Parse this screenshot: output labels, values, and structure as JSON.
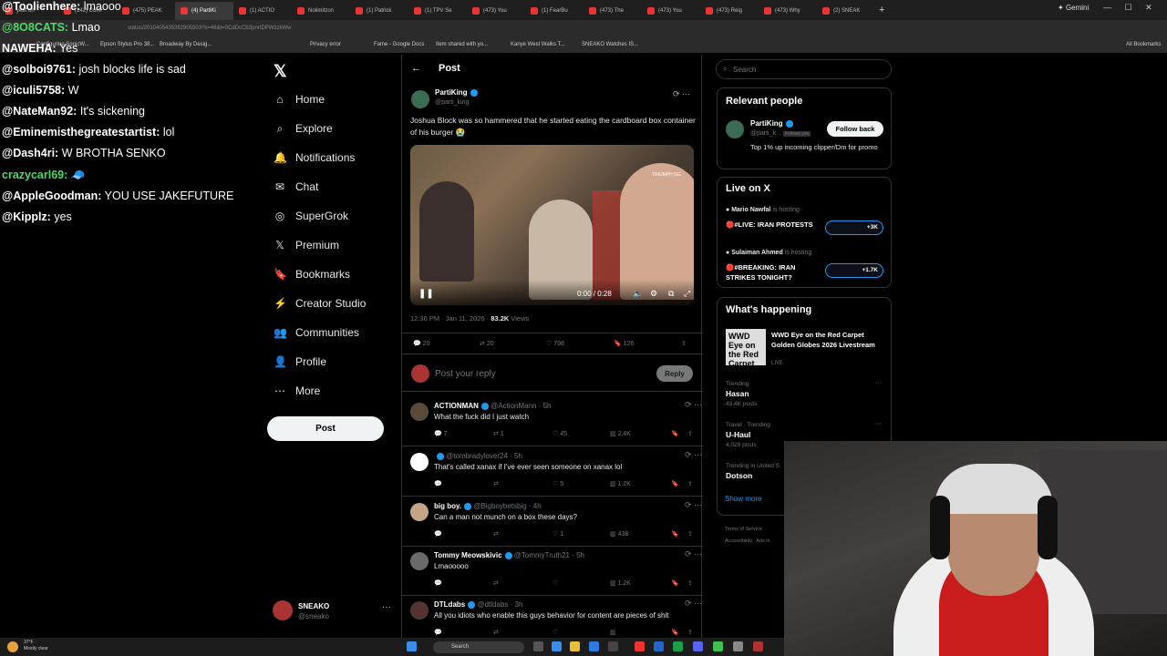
{
  "browser": {
    "tabs": [
      "yeet on",
      "(142) Confi",
      "(475) PEAK",
      "(4) PartiKi",
      "(1) ACTIO",
      "Nolimitzon",
      "(1) Patrick",
      "(1) TPV Se",
      "(473) You",
      "(1) FearBu",
      "(473) The",
      "(473) You",
      "(473) Reig",
      "(473) Why",
      "(2) SNEAK"
    ],
    "gemini_label": "Gemini",
    "url": "status/2010405435392905503?s=46&t=0CdDcCb3pnrtDPWzzkWw",
    "bookmarks": [
      "Configuring SonicW...",
      "Epson Stylus Pro 38...",
      "Broadway By Desig...",
      "Privacy error",
      "Fame - Google Docs",
      "Item shared with yo...",
      "Kanye West Walks T...",
      "SNEAKO Watches IS..."
    ],
    "all_bookmarks": "All Bookmarks"
  },
  "chat": [
    {
      "user": "@Toolienhere:",
      "msg": "lmaooo",
      "color": "#ffffff"
    },
    {
      "user": "@8O8CATS:",
      "msg": "Lmao",
      "color": "#4cd964"
    },
    {
      "user": "NAWEHA:",
      "msg": "Yes",
      "color": "#ffffff"
    },
    {
      "user": "@solboi9761:",
      "msg": "josh blocks life is sad",
      "color": "#ffffff"
    },
    {
      "user": "@iculi5758:",
      "msg": "W",
      "color": "#ffffff"
    },
    {
      "user": "@NateMan92:",
      "msg": "It's sickening",
      "color": "#ffffff"
    },
    {
      "user": "@Eminemisthegreatestartist:",
      "msg": "lol",
      "color": "#ffffff"
    },
    {
      "user": "@Dash4ri:",
      "msg": "W BROTHA SENKO",
      "color": "#ffffff"
    },
    {
      "user": "crazycarl69:",
      "msg": "🧢",
      "color": "#4cd964"
    },
    {
      "user": "@AppleGoodman:",
      "msg": "YOU USE JAKEFUTURE",
      "color": "#ffffff"
    },
    {
      "user": "@Kipplz:",
      "msg": "yes",
      "color": "#ffffff"
    }
  ],
  "nav": {
    "items": [
      "Home",
      "Explore",
      "Notifications",
      "Chat",
      "SuperGrok",
      "Premium",
      "Bookmarks",
      "Creator Studio",
      "Communities",
      "Profile",
      "More"
    ],
    "icons": [
      "home-icon",
      "search-icon",
      "bell-icon",
      "chat-icon",
      "grok-icon",
      "x-icon",
      "bookmark-icon",
      "creator-icon",
      "communities-icon",
      "profile-icon",
      "more-icon"
    ],
    "post_button": "Post",
    "account": {
      "name": "SNEAKO",
      "handle": "@sneako"
    }
  },
  "post": {
    "header": "Post",
    "author": "PartiKing",
    "handle": "@parti_king",
    "text": "Joshua Block was so hammered that he started eating the cardboard box container of his burger 😭",
    "video_time": "0:00 / 0:28",
    "video_watermark": "TRIUMPH GG",
    "timestamp": "12:36 PM · Jan 11, 2026 ·",
    "views": "83.2K",
    "views_label": "Views",
    "stats": {
      "replies": "20",
      "reposts": "20",
      "likes": "798",
      "bookmarks": "126"
    },
    "reply_placeholder": "Post your reply",
    "reply_button": "Reply"
  },
  "comments": [
    {
      "name": "ACTIONMAN",
      "handle": "@ActionMann · 5h",
      "text": "What the fuck did I just watch",
      "replies": "7",
      "reposts": "1",
      "likes": "45",
      "views": "2.4K"
    },
    {
      "name": "",
      "handle": "@tombradylover24 · 5h",
      "text": "That's called xanax if I've ever seen someone on xanax lol",
      "replies": "",
      "reposts": "",
      "likes": "5",
      "views": "1.2K"
    },
    {
      "name": "big boy.",
      "handle": "@Bigboybetsbig · 4h",
      "text": "Can a man not munch on a box these days?",
      "replies": "",
      "reposts": "",
      "likes": "1",
      "views": "438"
    },
    {
      "name": "Tommy Meowskivic",
      "handle": "@TommyTruth21 · 5h",
      "text": "Lmaooooo",
      "replies": "",
      "reposts": "",
      "likes": "",
      "views": "1.2K"
    },
    {
      "name": "DTLdabs",
      "handle": "@dtldabs · 3h",
      "text": "All you idiots who enable this guys behavior for content are pieces of shit",
      "replies": "",
      "reposts": "",
      "likes": "",
      "views": ""
    }
  ],
  "sidebar": {
    "search_placeholder": "Search",
    "relevant_title": "Relevant people",
    "relevant": {
      "name": "PartiKing",
      "handle": "@parti_k...",
      "follows_you": "Follows you",
      "bio": "Top 1% up incoming clipper/Dm for promo",
      "button": "Follow back"
    },
    "live_title": "Live on X",
    "live": [
      {
        "host": "Mario Nawfal",
        "status": "is hosting",
        "title": "🔴#LIVE: IRAN PROTESTS",
        "count": "+3K"
      },
      {
        "host": "Sulaiman Ahmed",
        "status": "is hosting",
        "title": "🔴#BREAKING: IRAN STRIKES TONIGHT?",
        "count": "+1.7K"
      }
    ],
    "happening_title": "What's happening",
    "happening_thumb": "WWD Eye on the Red Carpet",
    "happening_event": "WWD Eye on the Red Carpet Golden Globes 2026 Livestream",
    "happening_live": "LIVE",
    "trends": [
      {
        "context": "Trending",
        "name": "Hasan",
        "posts": "43.4K posts"
      },
      {
        "context": "Travel · Trending",
        "name": "U-Haul",
        "posts": "4,029 posts"
      },
      {
        "context": "Trending in United S",
        "name": "Dotson",
        "posts": ""
      }
    ],
    "show_more": "Show more",
    "footer": [
      "Terms of Service",
      "Accessibility",
      "Ads in"
    ]
  },
  "taskbar": {
    "temp": "37°F",
    "weather": "Mostly clear",
    "search": "Search"
  }
}
